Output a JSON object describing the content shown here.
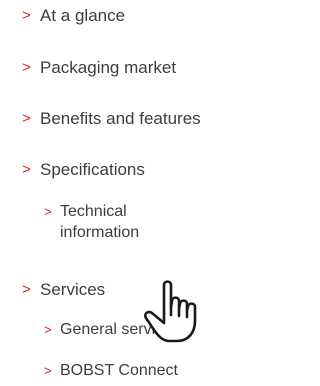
{
  "nav": {
    "chevron": ">",
    "items": [
      {
        "label": "At a glance"
      },
      {
        "label": "Packaging market"
      },
      {
        "label": "Benefits and features"
      },
      {
        "label": "Specifications"
      },
      {
        "label": "Technical information"
      },
      {
        "label": "Services"
      },
      {
        "label": "General services"
      },
      {
        "label": "BOBST Connect"
      }
    ]
  },
  "colors": {
    "accent": "#e2231a",
    "text": "#3d3d3d"
  },
  "cursor": {
    "icon": "hand-pointer-icon"
  }
}
